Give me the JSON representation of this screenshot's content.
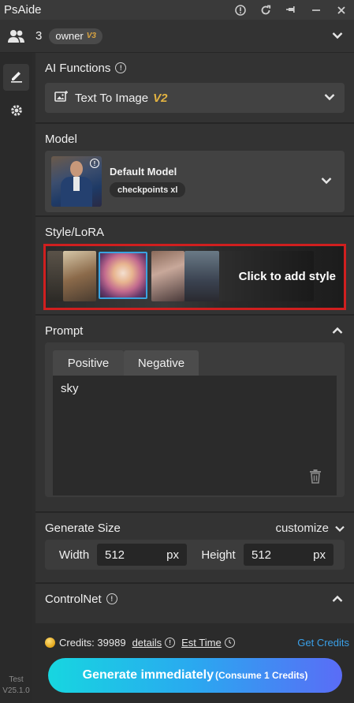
{
  "app": {
    "title": "PsAide"
  },
  "user": {
    "count": "3",
    "role": "owner",
    "role_version": "V3"
  },
  "sidebar": {
    "version_line1": "Test",
    "version_line2": "V25.1.0"
  },
  "ai_functions": {
    "heading": "AI Functions",
    "selected": "Text To Image",
    "selected_version": "V2"
  },
  "model": {
    "heading": "Model",
    "name": "Default Model",
    "tag": "checkpoints xl"
  },
  "style": {
    "heading": "Style/LoRA",
    "cta": "Click to add style"
  },
  "prompt": {
    "heading": "Prompt",
    "tabs": [
      "Positive",
      "Negative"
    ],
    "active_tab": "Negative",
    "text": "sky"
  },
  "size": {
    "heading": "Generate Size",
    "mode": "customize",
    "width_label": "Width",
    "width": "512",
    "height_label": "Height",
    "height": "512",
    "unit": "px"
  },
  "controlnet": {
    "heading": "ControlNet"
  },
  "footer": {
    "credits_label": "Credits: 39989",
    "details": "details",
    "est_time": "Est Time",
    "get_credits": "Get Credits",
    "generate": "Generate immediately",
    "generate_note": "(Consume 1 Credits)"
  },
  "colors": {
    "accent": "#3aa0e8",
    "highlight_border": "#d01f1f",
    "version_gold": "#e3b341"
  }
}
